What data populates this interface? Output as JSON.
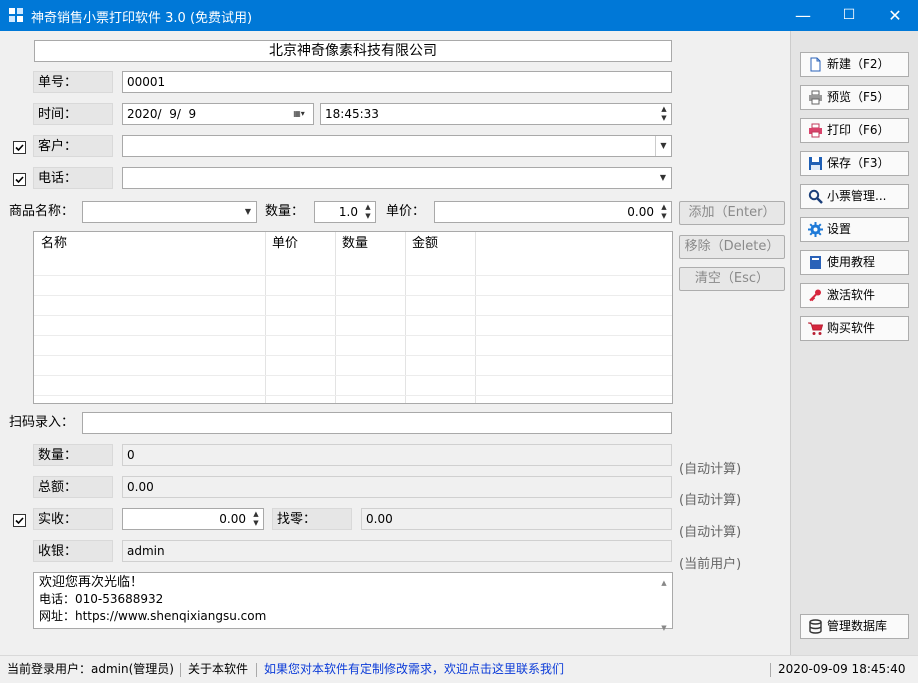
{
  "window": {
    "title": "神奇销售小票打印软件 3.0 (免费试用)",
    "minimize": "—",
    "maximize": "☐",
    "close": "✕"
  },
  "form": {
    "company": "北京神奇像素科技有限公司",
    "order_label": "单号：",
    "order_value": "00001",
    "time_label": "时间：",
    "date_value": "2020/  9/  9",
    "time_value": "18:45:33",
    "customer_label": "客户：",
    "customer_value": "",
    "phone_label": "电话：",
    "phone_value": "",
    "product_label": "商品名称：",
    "product_value": "",
    "qty_label": "数量：",
    "qty_value": "1.0",
    "price_label": "单价：",
    "price_value": "0.00",
    "scan_label": "扫码录入：",
    "scan_value": ""
  },
  "item_buttons": {
    "add": "添加（Enter）",
    "remove": "移除（Delete）",
    "clear": "清空（Esc）"
  },
  "table": {
    "headers": [
      "名称",
      "单价",
      "数量",
      "金额"
    ]
  },
  "summary": {
    "count_label": "数量：",
    "count_value": "0",
    "total_label": "总额：",
    "total_value": "0.00",
    "paid_label": "实收：",
    "paid_value": "0.00",
    "change_label": "找零：",
    "change_value": "0.00",
    "cashier_label": "收银：",
    "cashier_value": "admin",
    "auto1": "(自动计算)",
    "auto2": "(自动计算)",
    "auto3": "(自动计算)",
    "current_user": "(当前用户)"
  },
  "memo": {
    "line1": "欢迎您再次光临！",
    "line2": "电话：010-53688932",
    "line3": "网址：https://www.shenqixiangsu.com"
  },
  "sidebar": {
    "new": "新建（F2）",
    "preview": "预览（F5）",
    "print": "打印（F6）",
    "save": "保存（F3）",
    "manage": "小票管理...",
    "settings": "设置",
    "tutorial": "使用教程",
    "activate": "激活软件",
    "buy": "购买软件",
    "database": "管理数据库"
  },
  "status": {
    "user": "当前登录用户：admin(管理员)",
    "about": "关于本软件",
    "custom": "如果您对本软件有定制修改需求，欢迎点击这里联系我们",
    "datetime": "2020-09-09 18:45:40"
  },
  "colors": {
    "titlebar": "#0078d7",
    "link": "#0b3bd8"
  }
}
